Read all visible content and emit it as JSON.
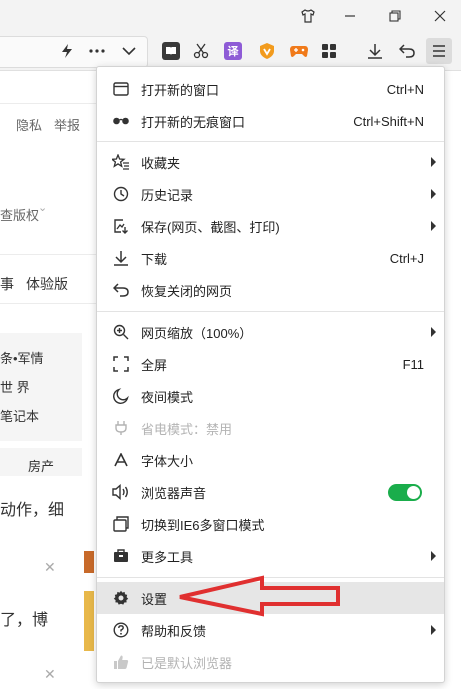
{
  "colors": {
    "toggle_on": "#1aad4b",
    "annotation_arrow": "#e03030",
    "highlight": "#e6e6e6"
  },
  "window": {
    "buttons": [
      "skin-icon",
      "minimize-icon",
      "restore-icon",
      "close-icon"
    ]
  },
  "page": {
    "header_links": [
      "隐私",
      "举报"
    ],
    "copyright": "查版权",
    "tabs": [
      "事",
      "体验版"
    ],
    "side_items": [
      "条•军情",
      "世 界",
      "笔记本"
    ],
    "tab_realestate": "房产",
    "article_1": "动作，细",
    "article_2": "了，博"
  },
  "menu": {
    "new_window": {
      "label": "打开新的窗口",
      "shortcut": "Ctrl+N"
    },
    "incognito": {
      "label": "打开新的无痕窗口",
      "shortcut": "Ctrl+Shift+N"
    },
    "favorites": {
      "label": "收藏夹"
    },
    "history": {
      "label": "历史记录"
    },
    "save": {
      "label": "保存(网页、截图、打印)"
    },
    "download": {
      "label": "下载",
      "shortcut": "Ctrl+J"
    },
    "restore_closed": {
      "label": "恢复关闭的网页"
    },
    "zoom": {
      "label": "网页缩放（100%）"
    },
    "fullscreen": {
      "label": "全屏",
      "shortcut": "F11"
    },
    "night_mode": {
      "label": "夜间模式"
    },
    "power_save": {
      "label": "省电模式：禁用"
    },
    "font_size": {
      "label": "字体大小"
    },
    "browser_sound": {
      "label": "浏览器声音",
      "toggle": "on"
    },
    "ie6_mode": {
      "label": "切换到IE6多窗口模式"
    },
    "more_tools": {
      "label": "更多工具"
    },
    "settings": {
      "label": "设置"
    },
    "help": {
      "label": "帮助和反馈"
    },
    "default_browser": {
      "label": "已是默认浏览器"
    }
  }
}
